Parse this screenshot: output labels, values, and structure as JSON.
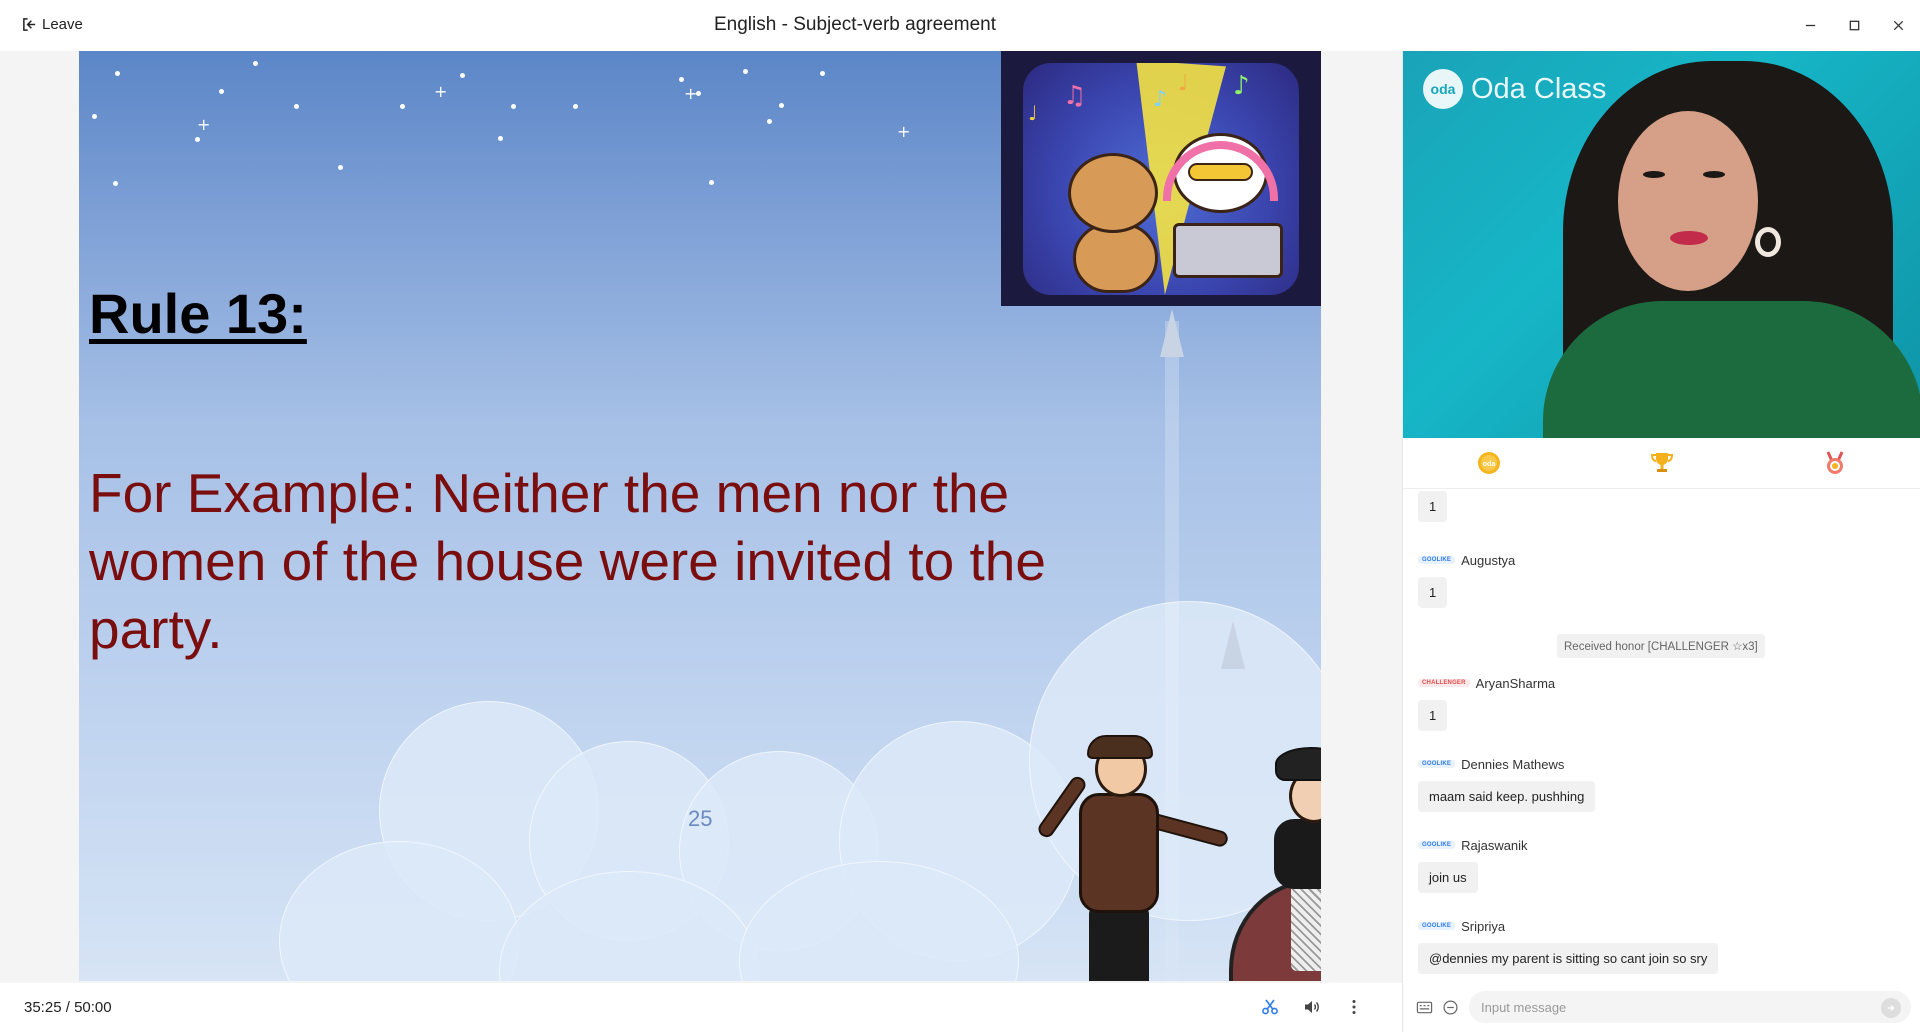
{
  "titlebar": {
    "leave_label": "Leave",
    "title": "English - Subject-verb agreement",
    "icons": [
      "minimize-icon",
      "maximize-icon",
      "close-icon"
    ]
  },
  "slide": {
    "rule_title": "Rule 13:",
    "example_text": "For Example: Neither the men nor the women of the house were invited to the party.",
    "page_number": "25"
  },
  "bottombar": {
    "time_elapsed": "35:25",
    "time_separator": "/",
    "time_total": "50:00",
    "icons": [
      "scissors-icon",
      "volume-icon",
      "more-vertical-icon"
    ]
  },
  "video": {
    "logo_text": "Oda Class",
    "logo_mark": "oda"
  },
  "tabs": [
    {
      "name": "chat-tab",
      "icon": "oda-coin-icon"
    },
    {
      "name": "leaderboard-tab",
      "icon": "trophy-icon"
    },
    {
      "name": "honor-tab",
      "icon": "medal-icon"
    }
  ],
  "chat": {
    "first_bubble": "1",
    "messages": [
      {
        "badge": "GOOLIKE",
        "badge_color": "#2d7cf0",
        "name": "Augustya",
        "text": "1"
      },
      {
        "badge": "CHALLENGER",
        "badge_color": "#e14a4a",
        "name": "AryanSharma",
        "text": "1"
      },
      {
        "badge": "GOOLIKE",
        "badge_color": "#2d7cf0",
        "name": "Dennies Mathews",
        "text": "maam said keep. pushhing"
      },
      {
        "badge": "GOOLIKE",
        "badge_color": "#2d7cf0",
        "name": "Rajaswanik",
        "text": "join us"
      },
      {
        "badge": "GOOLIKE",
        "badge_color": "#2d7cf0",
        "name": "Sripriya",
        "text": "@dennies my parent is sitting so cant join so sry"
      }
    ],
    "system_message": "Received honor [CHALLENGER ☆x3]"
  },
  "input": {
    "placeholder": "Input message",
    "value": ""
  },
  "colors": {
    "accent": "#2d7cf0",
    "example_text": "#7a0d0d",
    "video_bg": "#16b6c7"
  }
}
